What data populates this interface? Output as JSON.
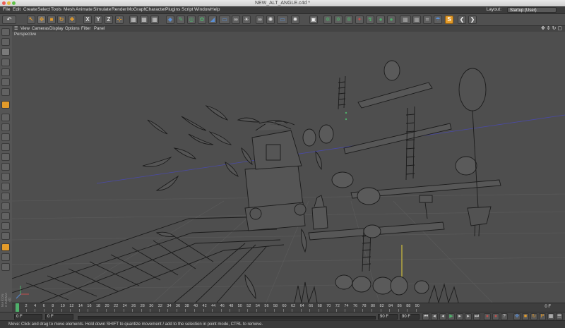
{
  "window": {
    "title": "NEW_ALT_ANGLE.c4d *"
  },
  "menubar": {
    "items": [
      "File",
      "Edit",
      "Create",
      "Select",
      "Tools",
      "Mesh",
      "Animate",
      "Simulate",
      "Render",
      "MoGraph",
      "Character",
      "Plugins",
      "Script",
      "Window",
      "Help"
    ],
    "layout_label": "Layout:",
    "layout_value": "Startup (User)"
  },
  "toolbar": {
    "axis_buttons": [
      "X",
      "Y",
      "Z"
    ]
  },
  "viewport_menu": {
    "items": [
      "View",
      "Cameras",
      "Display",
      "Options",
      "Filter",
      "Panel"
    ],
    "label": "Perspective"
  },
  "timeline": {
    "ticks": [
      "0",
      "2",
      "4",
      "6",
      "8",
      "10",
      "12",
      "14",
      "16",
      "18",
      "20",
      "22",
      "24",
      "26",
      "28",
      "30",
      "32",
      "34",
      "36",
      "38",
      "40",
      "42",
      "44",
      "46",
      "48",
      "50",
      "52",
      "54",
      "56",
      "58",
      "60",
      "62",
      "64",
      "66",
      "68",
      "70",
      "72",
      "74",
      "76",
      "78",
      "80",
      "82",
      "84",
      "86",
      "88",
      "90"
    ],
    "current_frame_label": "0 F"
  },
  "transport": {
    "start_field": "0 F",
    "current_field": "0 F",
    "end_field": "90 F",
    "max_field": "90 F"
  },
  "statusbar": {
    "text": "Move: Click and drag to move elements. Hold down SHIFT to quantize movement / add to the selection in point mode, CTRL to remove."
  },
  "branding": {
    "logo_text": "MAXON CINEMA 4D"
  },
  "colors": {
    "accent_orange": "#e39b2a",
    "accent_blue": "#5a8fd6",
    "accent_green": "#4fb06b",
    "wire_color": "#1b1b1b",
    "horizon_blue": "#4a4aa8",
    "axis_yellow": "#e6d23a"
  }
}
